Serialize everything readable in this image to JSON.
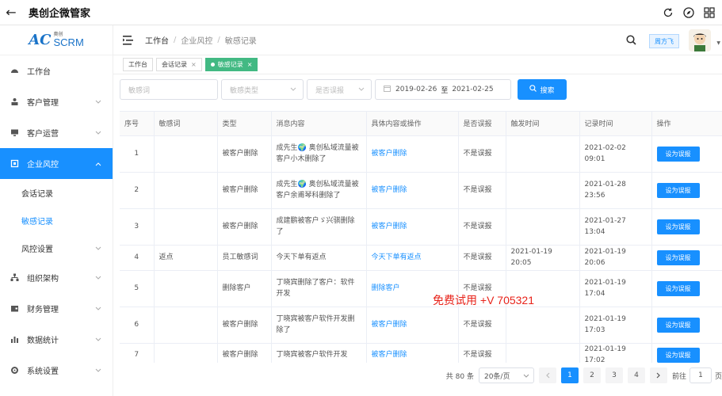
{
  "window": {
    "title": "奥创企微管家"
  },
  "logo": {
    "small": "奥创",
    "brand": "SCRM"
  },
  "sidebar": {
    "items": [
      {
        "label": "工作台",
        "icon": "gauge-icon"
      },
      {
        "label": "客户管理",
        "icon": "user-icon"
      },
      {
        "label": "客户运营",
        "icon": "monitor-icon"
      },
      {
        "label": "企业风控",
        "icon": "shield-icon"
      },
      {
        "label": "组织架构",
        "icon": "org-icon"
      },
      {
        "label": "财务管理",
        "icon": "wallet-icon"
      },
      {
        "label": "数据统计",
        "icon": "bar-chart-icon"
      },
      {
        "label": "系统设置",
        "icon": "gear-icon"
      }
    ],
    "sub": [
      {
        "label": "会话记录"
      },
      {
        "label": "敏感记录"
      },
      {
        "label": "风控设置"
      }
    ]
  },
  "breadcrumb": {
    "home": "工作台",
    "parent": "企业风控",
    "current": "敏感记录"
  },
  "header": {
    "user": "周方飞"
  },
  "tags": [
    {
      "label": "工作台"
    },
    {
      "label": "会话记录"
    },
    {
      "label": "敏感记录"
    }
  ],
  "filters": {
    "keyword_placeholder": "敏感词",
    "type_placeholder": "敏感类型",
    "misreport_placeholder": "是否误报",
    "date_start": "2019-02-26",
    "date_sep": "至",
    "date_end": "2021-02-25",
    "search_label": "搜索"
  },
  "table": {
    "headers": [
      "序号",
      "敏感词",
      "类型",
      "消息内容",
      "具体内容或操作",
      "是否误报",
      "触发时间",
      "记录时间",
      "操作"
    ],
    "rows": [
      {
        "no": "1",
        "word": "",
        "type": "被客户删除",
        "content": "成先生🌍 奥创私域流量被客户小木删除了",
        "detail": "被客户删除",
        "misreport": "不是误报",
        "trigger_time": "",
        "record_time": "2021-02-02 09:01",
        "action": "设为误报"
      },
      {
        "no": "2",
        "word": "",
        "type": "被客户删除",
        "content": "成先生🌍 奥创私域流量被客户余甫琴科删除了",
        "detail": "被客户删除",
        "misreport": "不是误报",
        "trigger_time": "",
        "record_time": "2021-01-28 23:56",
        "action": "设为误报"
      },
      {
        "no": "3",
        "word": "",
        "type": "被客户删除",
        "content": "成建鹏被客户ゞ兴骐删除了",
        "detail": "被客户删除",
        "misreport": "不是误报",
        "trigger_time": "",
        "record_time": "2021-01-27 13:04",
        "action": "设为误报"
      },
      {
        "no": "4",
        "word": "返点",
        "type": "员工敏感词",
        "content": "今天下单有返点",
        "detail": "今天下单有返点",
        "misreport": "不是误报",
        "trigger_time": "2021-01-19 20:05",
        "record_time": "2021-01-19 20:06",
        "action": "设为误报"
      },
      {
        "no": "5",
        "word": "",
        "type": "删除客户",
        "content": "丁晓宾删除了客户：软件开发",
        "detail": "删除客户",
        "misreport": "不是误报",
        "trigger_time": "",
        "record_time": "2021-01-19 17:04",
        "action": "设为误报"
      },
      {
        "no": "6",
        "word": "",
        "type": "被客户删除",
        "content": "丁晓宾被客户软件开发删除了",
        "detail": "被客户删除",
        "misreport": "不是误报",
        "trigger_time": "",
        "record_time": "2021-01-19 17:03",
        "action": "设为误报"
      },
      {
        "no": "7",
        "word": "",
        "type": "被客户删除",
        "content": "丁晓宾被客户软件开发",
        "detail": "被客户删除",
        "misreport": "不是误报",
        "trigger_time": "",
        "record_time": "2021-01-19 17:02",
        "action": "设为误报"
      }
    ]
  },
  "pager": {
    "total": "共 80 条",
    "page_size": "20条/页",
    "pages": [
      "1",
      "2",
      "3",
      "4"
    ],
    "goto_label": "前往",
    "goto_value": "1",
    "page_suffix": "页"
  },
  "watermark": "免费试用 +V 705321",
  "colors": {
    "primary": "#1890ff",
    "tag_active": "#42b983",
    "watermark": "#e8231a"
  }
}
